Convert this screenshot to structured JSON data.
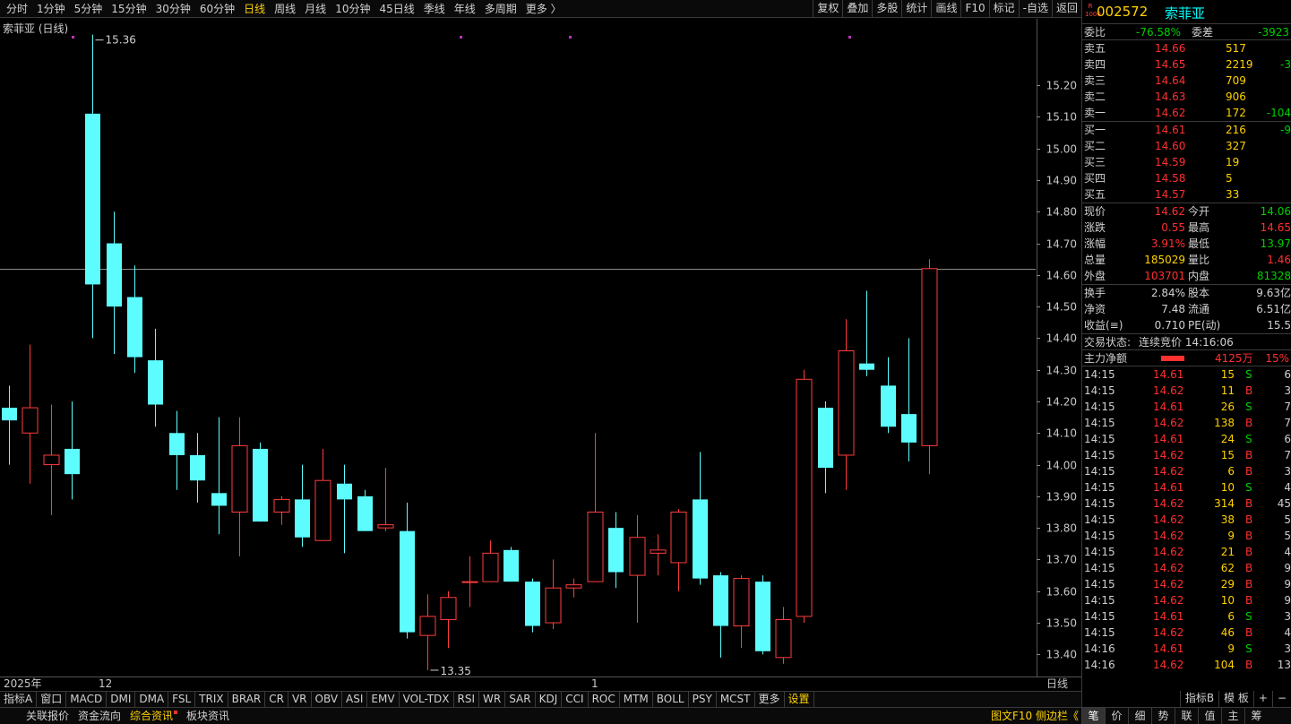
{
  "periods": [
    "分时",
    "1分钟",
    "5分钟",
    "15分钟",
    "30分钟",
    "60分钟",
    "日线",
    "周线",
    "月线",
    "10分钟",
    "45日线",
    "季线",
    "年线",
    "多周期",
    "更多 〉"
  ],
  "active_period": "日线",
  "tools": [
    "复权",
    "叠加",
    "多股",
    "统计",
    "画线",
    "F10",
    "标记",
    "-自选",
    "返回"
  ],
  "chart_title": "索菲亚 (日线)",
  "axis_labels": {
    "year": "2025年",
    "dec": "12",
    "jan": "1",
    "right": "日线"
  },
  "indicators": [
    "指标A",
    "窗口",
    "MACD",
    "DMI",
    "DMA",
    "FSL",
    "TRIX",
    "BRAR",
    "CR",
    "VR",
    "OBV",
    "ASI",
    "EMV",
    "VOL-TDX",
    "RSI",
    "WR",
    "SAR",
    "KDJ",
    "CCI",
    "ROC",
    "MTM",
    "BOLL",
    "PSY",
    "MCST",
    "更多",
    "设置"
  ],
  "ind_right": [
    "指标B",
    "模 板",
    "+",
    "−"
  ],
  "bottom_left": [
    "关联报价",
    "资金流向",
    "综合资讯",
    "板块资讯"
  ],
  "bottom_right": "图文F10 侧边栏《",
  "right_tabs": [
    "笔",
    "价",
    "细",
    "势",
    "联",
    "值",
    "主",
    "筹"
  ],
  "stock": {
    "code": "002572",
    "name": "索菲亚"
  },
  "ratio": {
    "l1": "委比",
    "v1": "-76.58%",
    "l2": "委差",
    "v2": "-3923"
  },
  "asks": [
    {
      "label": "卖五",
      "price": "14.66",
      "vol": "517",
      "chg": ""
    },
    {
      "label": "卖四",
      "price": "14.65",
      "vol": "2219",
      "chg": "-3"
    },
    {
      "label": "卖三",
      "price": "14.64",
      "vol": "709",
      "chg": ""
    },
    {
      "label": "卖二",
      "price": "14.63",
      "vol": "906",
      "chg": ""
    },
    {
      "label": "卖一",
      "price": "14.62",
      "vol": "172",
      "chg": "-104"
    }
  ],
  "bids": [
    {
      "label": "买一",
      "price": "14.61",
      "vol": "216",
      "chg": "-9"
    },
    {
      "label": "买二",
      "price": "14.60",
      "vol": "327",
      "chg": ""
    },
    {
      "label": "买三",
      "price": "14.59",
      "vol": "19",
      "chg": ""
    },
    {
      "label": "买四",
      "price": "14.58",
      "vol": "5",
      "chg": ""
    },
    {
      "label": "买五",
      "price": "14.57",
      "vol": "33",
      "chg": ""
    }
  ],
  "quote": [
    {
      "l1": "现价",
      "v1": "14.62",
      "c1": "red",
      "l2": "今开",
      "v2": "14.06",
      "c2": "green"
    },
    {
      "l1": "涨跌",
      "v1": "0.55",
      "c1": "red",
      "l2": "最高",
      "v2": "14.65",
      "c2": "red"
    },
    {
      "l1": "涨幅",
      "v1": "3.91%",
      "c1": "red",
      "l2": "最低",
      "v2": "13.97",
      "c2": "green"
    },
    {
      "l1": "总量",
      "v1": "185029",
      "c1": "yellow",
      "l2": "量比",
      "v2": "1.46",
      "c2": "red"
    },
    {
      "l1": "外盘",
      "v1": "103701",
      "c1": "red",
      "l2": "内盘",
      "v2": "81328",
      "c2": "green"
    }
  ],
  "fund": [
    {
      "l1": "换手",
      "v1": "2.84%",
      "l2": "股本",
      "v2": "9.63亿"
    },
    {
      "l1": "净资",
      "v1": "7.48",
      "l2": "流通",
      "v2": "6.51亿"
    },
    {
      "l1": "收益(≡)",
      "v1": "0.710",
      "l2": "PE(动)",
      "v2": "15.5"
    }
  ],
  "status": {
    "label": "交易状态:",
    "value": "连续竞价 14:16:06"
  },
  "mainflow": {
    "label": "主力净额",
    "value": "4125万",
    "pct": "15%"
  },
  "ticks": [
    {
      "t": "14:15",
      "p": "14.61",
      "v": "15",
      "bs": "S",
      "n": "6"
    },
    {
      "t": "14:15",
      "p": "14.62",
      "v": "11",
      "bs": "B",
      "n": "3"
    },
    {
      "t": "14:15",
      "p": "14.61",
      "v": "26",
      "bs": "S",
      "n": "7"
    },
    {
      "t": "14:15",
      "p": "14.62",
      "v": "138",
      "bs": "B",
      "n": "7"
    },
    {
      "t": "14:15",
      "p": "14.61",
      "v": "24",
      "bs": "S",
      "n": "6"
    },
    {
      "t": "14:15",
      "p": "14.62",
      "v": "15",
      "bs": "B",
      "n": "7"
    },
    {
      "t": "14:15",
      "p": "14.62",
      "v": "6",
      "bs": "B",
      "n": "3"
    },
    {
      "t": "14:15",
      "p": "14.61",
      "v": "10",
      "bs": "S",
      "n": "4"
    },
    {
      "t": "14:15",
      "p": "14.62",
      "v": "314",
      "bs": "B",
      "n": "45"
    },
    {
      "t": "14:15",
      "p": "14.62",
      "v": "38",
      "bs": "B",
      "n": "5"
    },
    {
      "t": "14:15",
      "p": "14.62",
      "v": "9",
      "bs": "B",
      "n": "5"
    },
    {
      "t": "14:15",
      "p": "14.62",
      "v": "21",
      "bs": "B",
      "n": "4"
    },
    {
      "t": "14:15",
      "p": "14.62",
      "v": "62",
      "bs": "B",
      "n": "9"
    },
    {
      "t": "14:15",
      "p": "14.62",
      "v": "29",
      "bs": "B",
      "n": "9"
    },
    {
      "t": "14:15",
      "p": "14.62",
      "v": "10",
      "bs": "B",
      "n": "9"
    },
    {
      "t": "14:15",
      "p": "14.61",
      "v": "6",
      "bs": "S",
      "n": "3"
    },
    {
      "t": "14:15",
      "p": "14.62",
      "v": "46",
      "bs": "B",
      "n": "4"
    },
    {
      "t": "14:16",
      "p": "14.61",
      "v": "9",
      "bs": "S",
      "n": "3"
    },
    {
      "t": "14:16",
      "p": "14.62",
      "v": "104",
      "bs": "B",
      "n": "13"
    }
  ],
  "chart_data": {
    "type": "candlestick",
    "title": "索菲亚 (日线)",
    "ylim": [
      13.33,
      15.41
    ],
    "yticks": [
      13.4,
      13.5,
      13.6,
      13.7,
      13.8,
      13.9,
      14.0,
      14.1,
      14.2,
      14.3,
      14.4,
      14.5,
      14.6,
      14.7,
      14.8,
      14.9,
      15.0,
      15.1,
      15.2
    ],
    "current_price": 14.62,
    "annotations": [
      {
        "text": "15.36",
        "price": 15.36
      },
      {
        "text": "13.35",
        "price": 13.35
      }
    ],
    "colors": {
      "up": "#ff3c3c",
      "down": "#5dfdff",
      "grid": "#555555"
    },
    "ohlc": [
      [
        14.18,
        14.25,
        14.0,
        14.14
      ],
      [
        14.1,
        14.38,
        13.94,
        14.18
      ],
      [
        14.0,
        14.19,
        13.84,
        14.03
      ],
      [
        14.05,
        14.2,
        13.89,
        13.97
      ],
      [
        15.11,
        15.36,
        14.4,
        14.57
      ],
      [
        14.7,
        14.8,
        14.35,
        14.5
      ],
      [
        14.53,
        14.63,
        14.29,
        14.34
      ],
      [
        14.33,
        14.43,
        14.12,
        14.19
      ],
      [
        14.1,
        14.17,
        13.92,
        14.03
      ],
      [
        14.03,
        14.1,
        13.88,
        13.95
      ],
      [
        13.91,
        14.15,
        13.78,
        13.87
      ],
      [
        13.85,
        14.15,
        13.71,
        14.06
      ],
      [
        14.05,
        14.07,
        13.82,
        13.82
      ],
      [
        13.85,
        13.9,
        13.81,
        13.89
      ],
      [
        13.89,
        14.0,
        13.74,
        13.77
      ],
      [
        13.76,
        14.05,
        13.76,
        13.95
      ],
      [
        13.94,
        14.0,
        13.72,
        13.89
      ],
      [
        13.9,
        13.92,
        13.79,
        13.79
      ],
      [
        13.8,
        13.99,
        13.79,
        13.81
      ],
      [
        13.79,
        13.88,
        13.45,
        13.47
      ],
      [
        13.46,
        13.59,
        13.35,
        13.52
      ],
      [
        13.51,
        13.6,
        13.42,
        13.58
      ],
      [
        13.63,
        13.71,
        13.55,
        13.63
      ],
      [
        13.63,
        13.76,
        13.63,
        13.72
      ],
      [
        13.73,
        13.74,
        13.63,
        13.63
      ],
      [
        13.63,
        13.64,
        13.47,
        13.49
      ],
      [
        13.5,
        13.7,
        13.48,
        13.61
      ],
      [
        13.61,
        13.64,
        13.58,
        13.62
      ],
      [
        13.63,
        14.1,
        13.63,
        13.85
      ],
      [
        13.8,
        13.85,
        13.61,
        13.66
      ],
      [
        13.65,
        13.84,
        13.5,
        13.77
      ],
      [
        13.72,
        13.78,
        13.65,
        13.73
      ],
      [
        13.69,
        13.86,
        13.6,
        13.85
      ],
      [
        13.89,
        14.04,
        13.62,
        13.64
      ],
      [
        13.65,
        13.66,
        13.39,
        13.49
      ],
      [
        13.49,
        13.65,
        13.42,
        13.64
      ],
      [
        13.63,
        13.65,
        13.4,
        13.41
      ],
      [
        13.39,
        13.55,
        13.37,
        13.51
      ],
      [
        13.52,
        14.3,
        13.5,
        14.27
      ],
      [
        14.18,
        14.2,
        13.91,
        13.99
      ],
      [
        14.03,
        14.46,
        13.92,
        14.36
      ],
      [
        14.32,
        14.55,
        14.28,
        14.3
      ],
      [
        14.25,
        14.34,
        14.1,
        14.12
      ],
      [
        14.16,
        14.4,
        14.01,
        14.07
      ],
      [
        14.06,
        14.65,
        13.97,
        14.62
      ]
    ]
  }
}
